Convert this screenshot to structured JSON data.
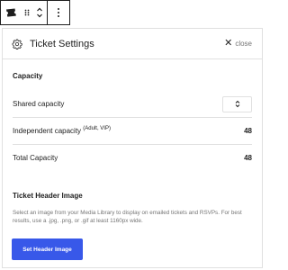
{
  "toolbar": {
    "block_icon": "ticket-icon",
    "drag_icon": "drag-handle-icon",
    "move_icon": "move-up-down-icon",
    "more_icon": "more-vertical-icon"
  },
  "panel": {
    "title": "Ticket Settings",
    "close_label": "close"
  },
  "capacity": {
    "heading": "Capacity",
    "shared_label": "Shared capacity",
    "independent_label": "Independent capacity",
    "independent_note": "(Adult, VIP)",
    "independent_value": "48",
    "total_label": "Total Capacity",
    "total_value": "48"
  },
  "header_image": {
    "heading": "Ticket Header Image",
    "description": "Select an image from your Media Library to display on emailed tickets and RSVPs. For best results, use a .jpg, .png, or .gif at least 1160px wide.",
    "button_label": "Set Header Image"
  },
  "colors": {
    "accent": "#3858e9",
    "text": "#1e1e1e",
    "muted": "#757575",
    "border": "#e0e0e0"
  }
}
